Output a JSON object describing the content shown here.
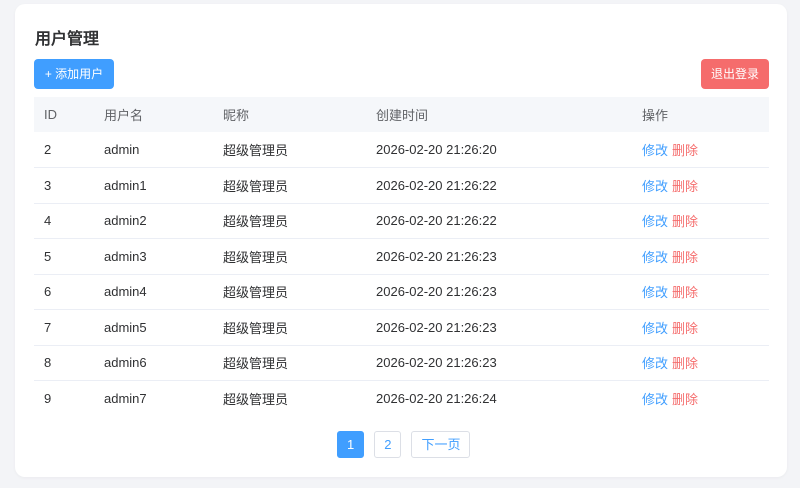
{
  "page": {
    "title": "用户管理",
    "add_button": "+ 添加用户",
    "logout_button": "退出登录"
  },
  "table": {
    "headers": [
      "ID",
      "用户名",
      "昵称",
      "创建时间",
      "操作"
    ],
    "edit_label": "修改",
    "delete_label": "删除",
    "rows": [
      {
        "id": "2",
        "username": "admin",
        "nickname": "超级管理员",
        "created": "2026-02-20 21:26:20"
      },
      {
        "id": "3",
        "username": "admin1",
        "nickname": "超级管理员",
        "created": "2026-02-20 21:26:22"
      },
      {
        "id": "4",
        "username": "admin2",
        "nickname": "超级管理员",
        "created": "2026-02-20 21:26:22"
      },
      {
        "id": "5",
        "username": "admin3",
        "nickname": "超级管理员",
        "created": "2026-02-20 21:26:23"
      },
      {
        "id": "6",
        "username": "admin4",
        "nickname": "超级管理员",
        "created": "2026-02-20 21:26:23"
      },
      {
        "id": "7",
        "username": "admin5",
        "nickname": "超级管理员",
        "created": "2026-02-20 21:26:23"
      },
      {
        "id": "8",
        "username": "admin6",
        "nickname": "超级管理员",
        "created": "2026-02-20 21:26:23"
      },
      {
        "id": "9",
        "username": "admin7",
        "nickname": "超级管理员",
        "created": "2026-02-20 21:26:24"
      }
    ]
  },
  "pagination": {
    "pages": [
      "1",
      "2"
    ],
    "current": "1",
    "next_label": "下一页"
  }
}
